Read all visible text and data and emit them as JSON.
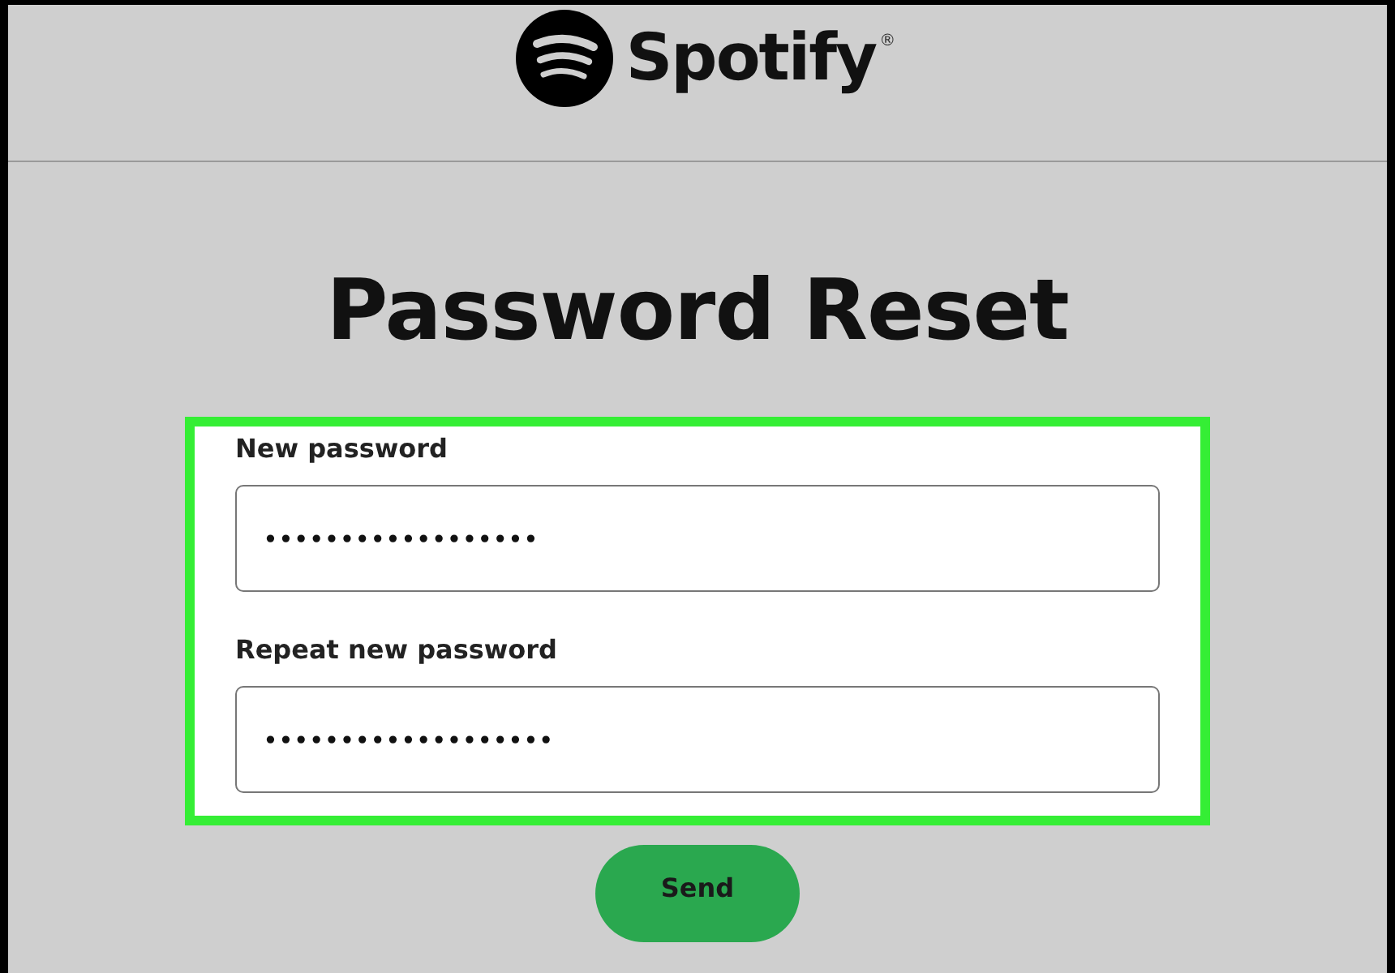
{
  "header": {
    "logo_text": "Spotify",
    "registered_mark": "®"
  },
  "title": "Password Reset",
  "form": {
    "highlighted": true,
    "fields": [
      {
        "label": "New password",
        "value": "••••••••••••••••••"
      },
      {
        "label": "Repeat new password",
        "value": "•••••••••••••••••••"
      }
    ]
  },
  "button": "Send"
}
